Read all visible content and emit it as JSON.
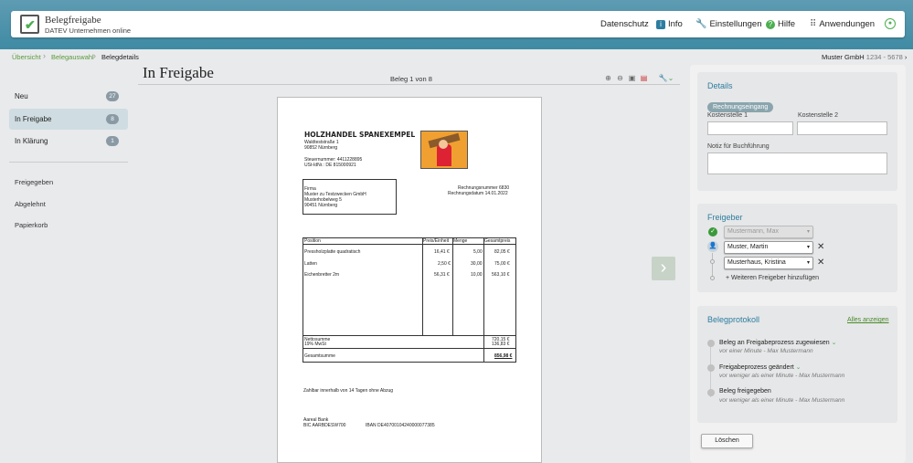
{
  "app": {
    "title": "Belegfreigabe",
    "subtitle": "DATEV Unternehmen online"
  },
  "nav": {
    "privacy": "Datenschutz",
    "info": "Info",
    "settings": "Einstellungen",
    "help": "Hilfe",
    "apps": "Anwendungen"
  },
  "breadcrumb": {
    "items": [
      "Übersicht",
      "Belegauswahl",
      "Belegdetails"
    ]
  },
  "company": {
    "name": "Muster GmbH",
    "ids": "1234 - 5678"
  },
  "sidebar": {
    "items": [
      {
        "label": "Neu",
        "count": "27"
      },
      {
        "label": "In Freigabe",
        "count": "8"
      },
      {
        "label": "In Klärung",
        "count": "1"
      }
    ],
    "sub": [
      "Freigegeben",
      "Abgelehnt",
      "Papierkorb"
    ]
  },
  "page": {
    "title": "In Freigabe",
    "counter": "Beleg 1 von 8"
  },
  "invoice": {
    "company": "HOLZHANDEL SPANEXEMPEL",
    "street": "Waldteststraße 1",
    "city": "90852 Nürnberg",
    "tax": "Steuernummer: 4411228895",
    "vat": "USt-IdNr.: DE 815000921",
    "recipient": [
      "Firma",
      "Muster zu Testzwecken  GmbH",
      "Musterhobelweg 5",
      "90451 Nürnberg"
    ],
    "inv_no": "Rechnungsnummer 6830",
    "inv_date": "Rechnungsdatum 14.01.2022",
    "headers": [
      "Position",
      "Preis/Einheit",
      "Menge",
      "Gesamtpreis"
    ],
    "rows": [
      [
        "Pressholzplatte quadratisch",
        "16,41 €",
        "5,00",
        "82,05 €"
      ],
      [
        "Latten",
        "2,50 €",
        "30,00",
        "75,00 €"
      ],
      [
        "Eichenbretter 2m",
        "56,31 €",
        "10,00",
        "563,10 €"
      ]
    ],
    "net_label": "Nettosumme",
    "net": "720,15 €",
    "vat_label": "19% MwSt",
    "vat_amt": "136,83 €",
    "total_label": "Gesamtsumme",
    "total": "856,98 €",
    "terms": "Zahlbar innerhalb von 14 Tagen ohne Abzug",
    "bank": "Aareal Bank",
    "bic": "BIC AARBDESW700",
    "iban": "IBAN DE40700104240000077385"
  },
  "details": {
    "title": "Details",
    "tag": "Rechnungseingang",
    "cost1": "Kostenstelle 1",
    "cost2": "Kostenstelle 2",
    "note": "Notiz für Buchführung"
  },
  "approvers": {
    "title": "Freigeber",
    "list": [
      "Mustermann, Max",
      "Muster, Martin",
      "Musterhaus, Kristina"
    ],
    "add": "+ Weiteren Freigeber hinzufügen"
  },
  "log": {
    "title": "Belegprotokoll",
    "show_all": "Alles anzeigen",
    "entries": [
      {
        "main": "Beleg an Freigabeprozess zugewiesen",
        "sub": "vor einer Minute - Max Mustermann"
      },
      {
        "main": "Freigabeprozess geändert",
        "sub": "vor weniger als einer Minute - Max Mustermann"
      },
      {
        "main": "Beleg freigegeben",
        "sub": "vor weniger als einer Minute - Max Mustermann"
      }
    ]
  },
  "actions": {
    "delete": "Löschen"
  }
}
